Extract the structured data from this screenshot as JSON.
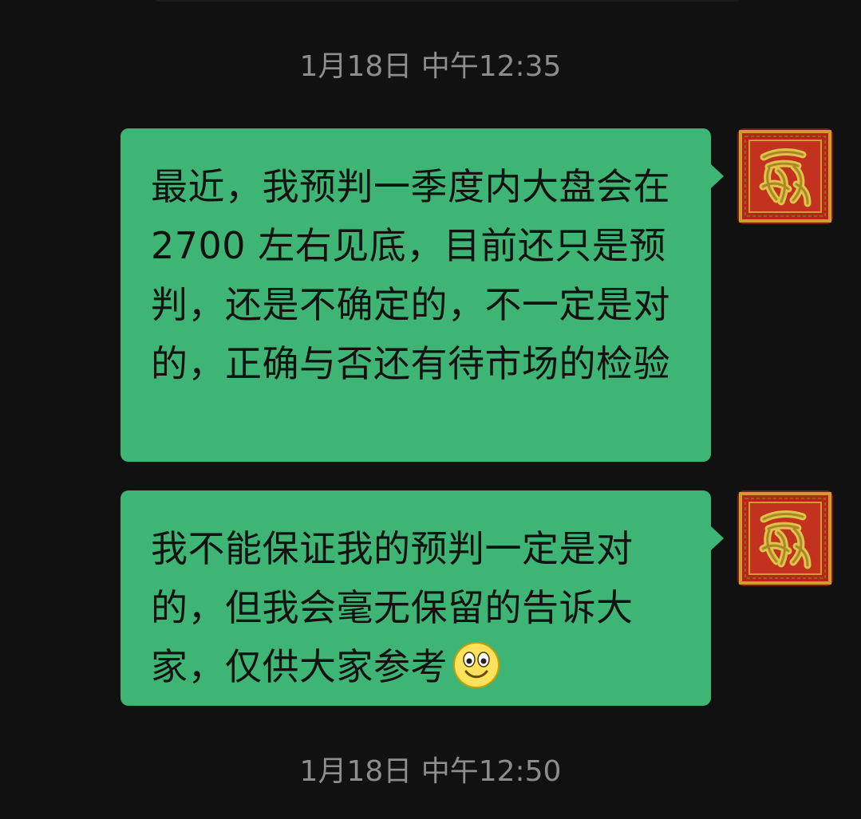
{
  "chat": {
    "timestamps": [
      "1月18日 中午12:35",
      "1月18日 中午12:50"
    ],
    "messages": [
      {
        "sender": "self",
        "text": "最近，我预判一季度内大盘会在 2700 左右见底，目前还只是预判，还是不确定的，不一定是对的，正确与否还有待市场的检验",
        "avatar_icon": "red-seal-avatar-icon"
      },
      {
        "sender": "self",
        "text": "我不能保证我的预判一定是对的，但我会毫无保留的告诉大家，仅供大家参考",
        "trailing_icon": "smiley-emoji-icon",
        "avatar_icon": "red-seal-avatar-icon"
      }
    ]
  },
  "colors": {
    "background": "#111111",
    "bubble": "#3eb575",
    "timestamp_text": "#8d8d8d",
    "avatar_red": "#b3261e",
    "avatar_gold": "#c9a227"
  }
}
